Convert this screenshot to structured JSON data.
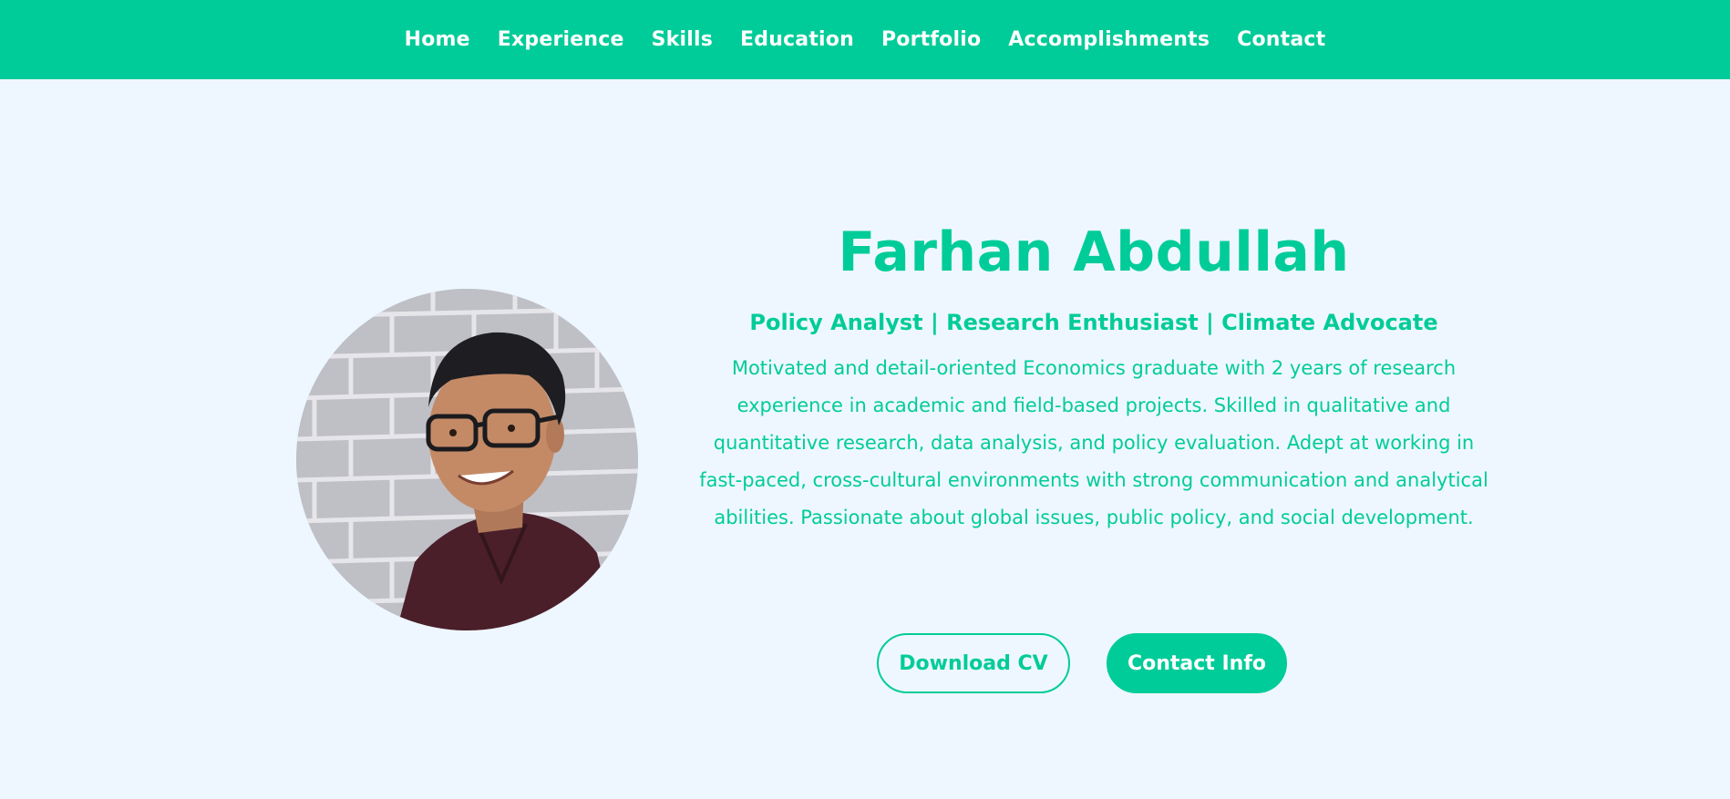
{
  "nav": {
    "items": [
      {
        "label": "Home"
      },
      {
        "label": "Experience"
      },
      {
        "label": "Skills"
      },
      {
        "label": "Education"
      },
      {
        "label": "Portfolio"
      },
      {
        "label": "Accomplishments"
      },
      {
        "label": "Contact"
      }
    ]
  },
  "hero": {
    "name": "Farhan Abdullah",
    "tagline": "Policy Analyst | Research Enthusiast | Climate Advocate",
    "bio": "Motivated and detail-oriented Economics graduate with 2 years of research experience in academic and field-based projects. Skilled in qualitative and quantitative research, data analysis, and policy evaluation. Adept at working in fast-paced, cross-cultural environments with strong communication and analytical abilities. Passionate about global issues, public policy, and social development.",
    "buttons": {
      "download": "Download CV",
      "contact": "Contact Info"
    }
  },
  "theme": {
    "accent": "#00cc99",
    "background": "#eef7ff"
  }
}
